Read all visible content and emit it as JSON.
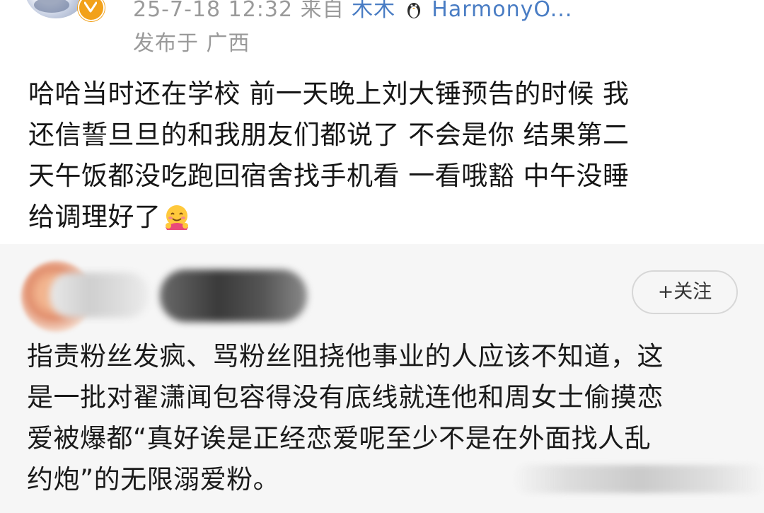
{
  "post": {
    "meta": {
      "date_time": "25-7-18 12:32",
      "source_prefix": "来自",
      "source_name": "木木",
      "source_device": "HarmonyO..."
    },
    "location": "发布于 广西",
    "text_lines": [
      "哈哈当时还在学校 前一天晚上刘大锤预告的时候 我",
      "还信誓旦旦的和我朋友们都说了 不会是你 结果第二",
      "天午饭都没吃跑回宿舍找手机看 一看哦豁 中午没睡",
      "给调理好了"
    ],
    "emoji": "hug-emoji"
  },
  "quoted": {
    "follow_label": "+关注",
    "text_lines": [
      "指责粉丝发疯、骂粉丝阻挠他事业的人应该不知道，这",
      "是一批对翟潇闻包容得没有底线就连他和周女士偷摸恋",
      "爱被爆都“真好诶是正经恋爱呢至少不是在外面找人乱",
      "约炮”的无限溺爱粉。"
    ]
  },
  "colors": {
    "meta_grey": "#9a9a9a",
    "link_blue": "#4a7dc4",
    "vip_orange": "#f2a11a",
    "quote_bg": "#f6f6f6"
  }
}
